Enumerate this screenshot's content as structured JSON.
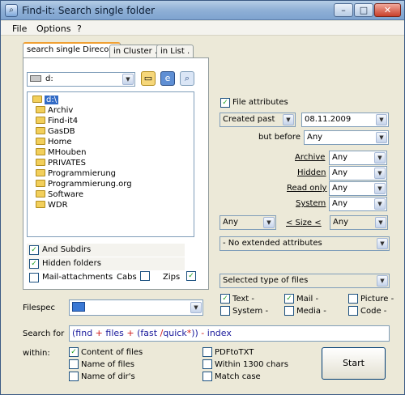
{
  "window": {
    "title": "Find-it: Search single folder",
    "controls": {
      "minimize": "–",
      "maximize": "□",
      "close": "✕"
    }
  },
  "menu": [
    "File",
    "Options",
    "?"
  ],
  "tabs": [
    "search single Direcory",
    "in Cluster .",
    "in List ."
  ],
  "drive": {
    "value": "d:"
  },
  "tree": {
    "root": "d:\\",
    "folders": [
      "Archiv",
      "Find-it4",
      "GasDB",
      "Home",
      "MHouben",
      "PRIVATES",
      "Programmierung",
      "Programmierung.org",
      "Software",
      "WDR"
    ]
  },
  "options": {
    "and_subdirs": {
      "label": "And Subdirs",
      "checked": true
    },
    "hidden_folders": {
      "label": "Hidden folders",
      "checked": true
    },
    "mail_attachments": {
      "label": "Mail-attachments",
      "checked": false
    },
    "cabs": {
      "label": "Cabs",
      "checked": false
    },
    "zips": {
      "label": "Zips",
      "checked": true
    }
  },
  "file_attributes": {
    "label": "File attributes",
    "checked": true,
    "created_mode": "Created past",
    "date": "08.11.2009",
    "but_before_label": "but before",
    "but_before_value": "Any",
    "rows": [
      {
        "label": "Archive",
        "value": "Any"
      },
      {
        "label": "Hidden",
        "value": "Any"
      },
      {
        "label": "Read only",
        "value": "Any"
      },
      {
        "label": "System",
        "value": "Any"
      }
    ],
    "size_from": "Any",
    "size_label": "< Size <",
    "size_to": "Any",
    "extended": "- No extended attributes"
  },
  "file_types": {
    "selector": "Selected type of files",
    "items": [
      {
        "label": "Text -",
        "checked": true
      },
      {
        "label": "Mail -",
        "checked": true
      },
      {
        "label": "Picture -",
        "checked": false
      },
      {
        "label": "System -",
        "checked": false
      },
      {
        "label": "Media -",
        "checked": false
      },
      {
        "label": "Code -",
        "checked": false
      }
    ]
  },
  "filespec": {
    "label": "Filespec",
    "value": ""
  },
  "search": {
    "label": "Search for",
    "tokens": [
      {
        "text": "(",
        "color": "#1a1a9c"
      },
      {
        "text": "find",
        "color": "#1a1a9c"
      },
      {
        "text": " + ",
        "color": "#d01a1a"
      },
      {
        "text": "files",
        "color": "#1a1a9c"
      },
      {
        "text": " + ",
        "color": "#d01a1a"
      },
      {
        "text": "(",
        "color": "#1a1a9c"
      },
      {
        "text": "fast",
        "color": "#1a1a9c"
      },
      {
        "text": " /",
        "color": "#d01a1a"
      },
      {
        "text": "quick",
        "color": "#1a1a9c"
      },
      {
        "text": "*",
        "color": "#d01a1a"
      },
      {
        "text": "))",
        "color": "#1a1a9c"
      },
      {
        "text": " - ",
        "color": "#d01a1a"
      },
      {
        "text": "index",
        "color": "#1a1a9c"
      }
    ]
  },
  "within": {
    "label": "within:",
    "left": [
      {
        "label": "Content of files",
        "checked": true
      },
      {
        "label": "Name of files",
        "checked": false
      },
      {
        "label": "Name of dir's",
        "checked": false
      }
    ],
    "right": [
      {
        "label": "PDFtoTXT",
        "checked": false
      },
      {
        "label": "Within  1300 chars",
        "checked": false
      },
      {
        "label": "Match case",
        "checked": false
      }
    ]
  },
  "start_button": "Start",
  "icons": {
    "app": "magnifier-icon",
    "drive": "drive-icon",
    "folder": "folder-icon",
    "tool1": "folder-open-icon",
    "tool2": "explorer-icon",
    "tool3": "search-folder-icon",
    "filespec": "filespec-icon"
  },
  "colors": {
    "selection": "#316ac5",
    "check": "#21a121",
    "tab_highlight": "#f0a033"
  }
}
